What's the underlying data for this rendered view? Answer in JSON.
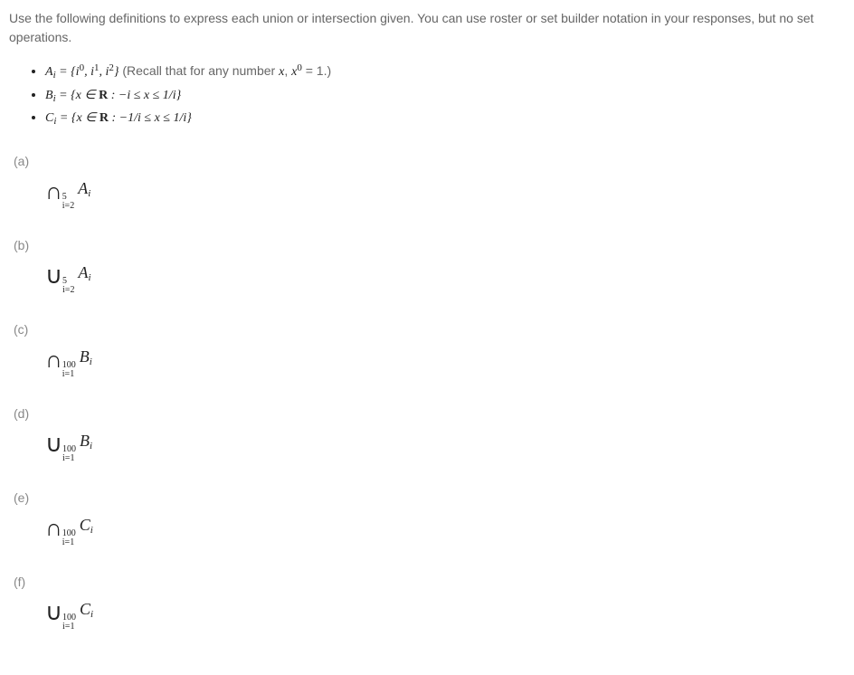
{
  "instructions": "Use the following definitions to express each union or intersection given. You can use roster or set builder notation in your responses, but no set operations.",
  "def_recall_prefix": " (Recall that for any number ",
  "def_recall_var": "x",
  "def_recall_mid": ", ",
  "def_recall_eq": " = 1",
  "def_recall_suffix": ".)",
  "labels": {
    "a": "(a)",
    "b": "(b)",
    "c": "(c)",
    "d": "(d)",
    "e": "(e)",
    "f": "(f)"
  },
  "ops": {
    "a": "∩",
    "b": "∪",
    "c": "∩",
    "d": "∪",
    "e": "∩",
    "f": "∪"
  },
  "limits": {
    "a_top": "5",
    "a_bot": "i=2",
    "b_top": "5",
    "b_bot": "i=2",
    "c_top": "100",
    "c_bot": "i=1",
    "d_top": "100",
    "d_bot": "i=1",
    "e_top": "100",
    "e_bot": "i=1",
    "f_top": "100",
    "f_bot": "i=1"
  },
  "vars": {
    "A": "A",
    "B": "B",
    "C": "C",
    "i": "i"
  }
}
